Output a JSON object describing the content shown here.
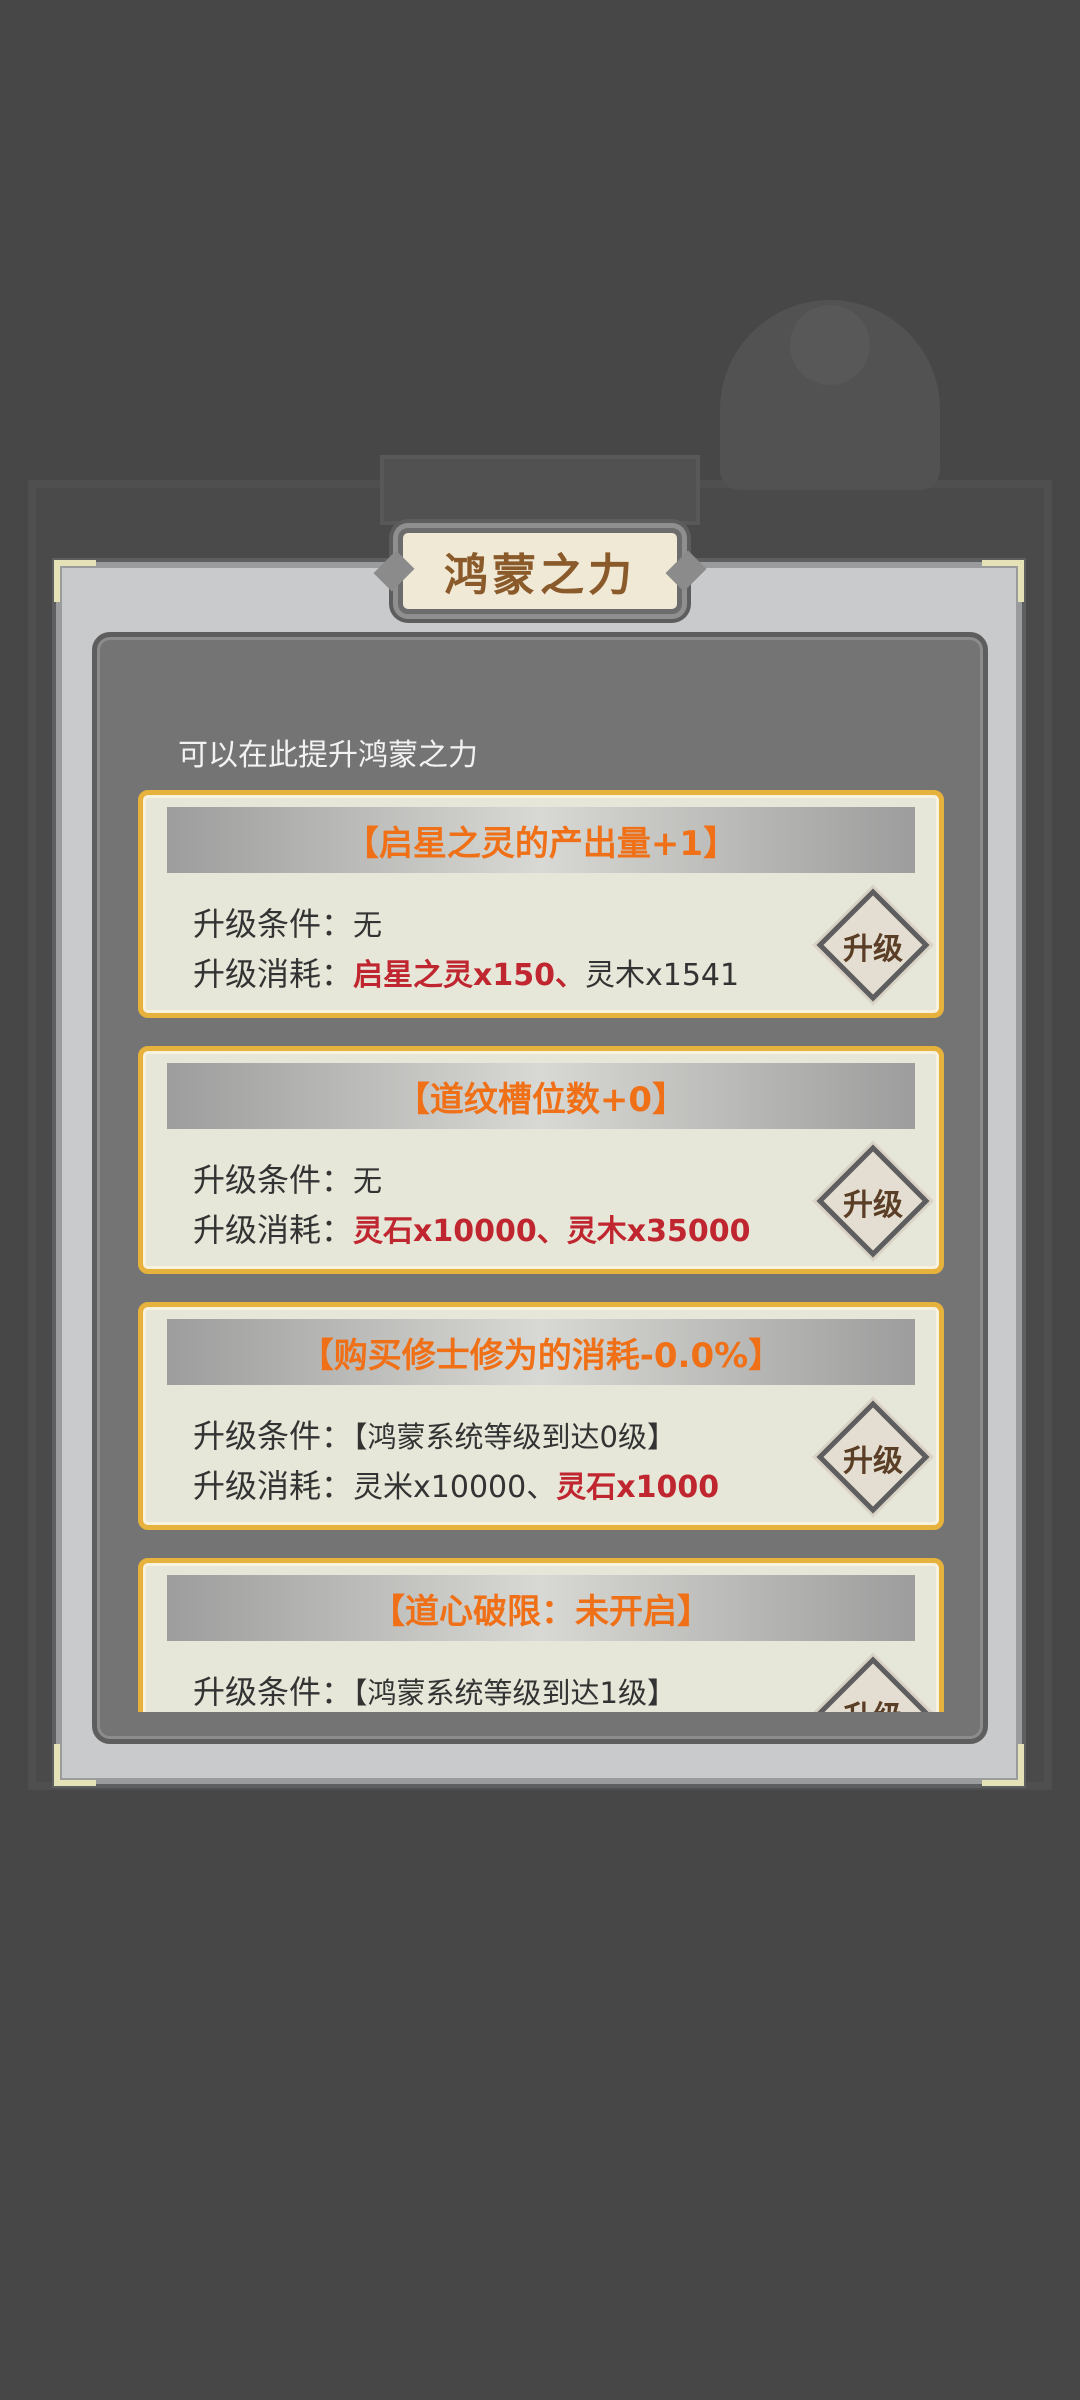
{
  "dialog": {
    "title": "鸿蒙之力",
    "intro": "可以在此提升鸿蒙之力"
  },
  "labels": {
    "condition": "升级条件：",
    "cost": "升级消耗："
  },
  "upgrade_button_label": "升级",
  "cards": [
    {
      "title": "【启星之灵的产出量+1】",
      "condition": "无",
      "cost_part1": "启星之灵x150、",
      "cost_part2": "灵木x1541"
    },
    {
      "title": "【道纹槽位数+0】",
      "condition": "无",
      "cost_part1": "灵石x10000、",
      "cost_part2": "灵木x35000"
    },
    {
      "title": "【购买修士修为的消耗-0.0%】",
      "condition": "【鸿蒙系统等级到达0级】",
      "cost_part1": "灵米x10000、",
      "cost_part2": "灵石x1000"
    },
    {
      "title": "【道心破限：未开启】",
      "condition": "【鸿蒙系统等级到达1级】"
    }
  ],
  "colors": {
    "accent_orange": "#f07018",
    "cost_red": "#c0262f",
    "card_border": "#e6b23c",
    "title_brown": "#8a5a2a"
  }
}
